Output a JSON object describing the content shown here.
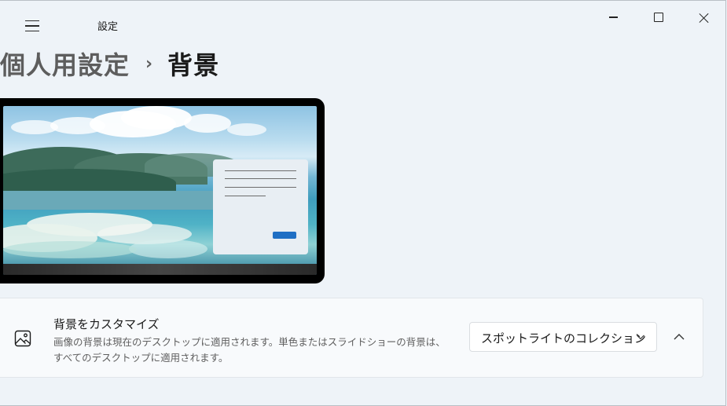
{
  "window": {
    "title": "設定",
    "controls": {
      "minimize_icon": "minimize-icon",
      "maximize_icon": "maximize-icon",
      "close_icon": "close-icon"
    }
  },
  "nav": {
    "menu_icon": "hamburger-icon"
  },
  "breadcrumb": {
    "parent": "個人用設定",
    "separator": "›",
    "current": "背景"
  },
  "preview": {
    "description_icon": "desktop-preview"
  },
  "background_setting": {
    "icon": "picture-icon",
    "title": "背景をカスタマイズ",
    "description": "画像の背景は現在のデスクトップに適用されます。単色またはスライドショーの背景は、すべてのデスクトップに適用されます。",
    "dropdown_value": "スポットライトのコレクション",
    "dropdown_icon": "chevron-down-icon",
    "expand_icon": "chevron-up-icon"
  },
  "colors": {
    "accent": "#1f6fc4",
    "background": "#eef3f8",
    "card": "#f8fafc"
  }
}
